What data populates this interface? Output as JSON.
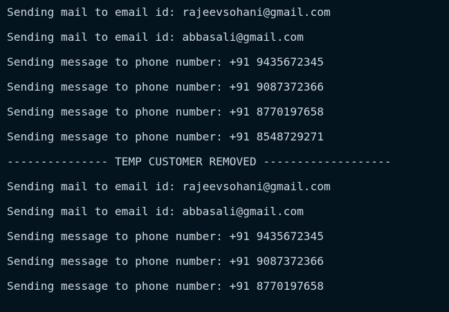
{
  "terminal": {
    "lines": [
      "Sending mail to email id: rajeevsohani@gmail.com",
      "Sending mail to email id: abbasali@gmail.com",
      "Sending message to phone number: +91 9435672345",
      "Sending message to phone number: +91 9087372366",
      "Sending message to phone number: +91 8770197658",
      "Sending message to phone number: +91 8548729271",
      "--------------- TEMP CUSTOMER REMOVED -------------------",
      "Sending mail to email id: rajeevsohani@gmail.com",
      "Sending mail to email id: abbasali@gmail.com",
      "Sending message to phone number: +91 9435672345",
      "Sending message to phone number: +91 9087372366",
      "Sending message to phone number: +91 8770197658"
    ]
  },
  "colors": {
    "background": "#03141f",
    "text": "#cfd6dd"
  }
}
